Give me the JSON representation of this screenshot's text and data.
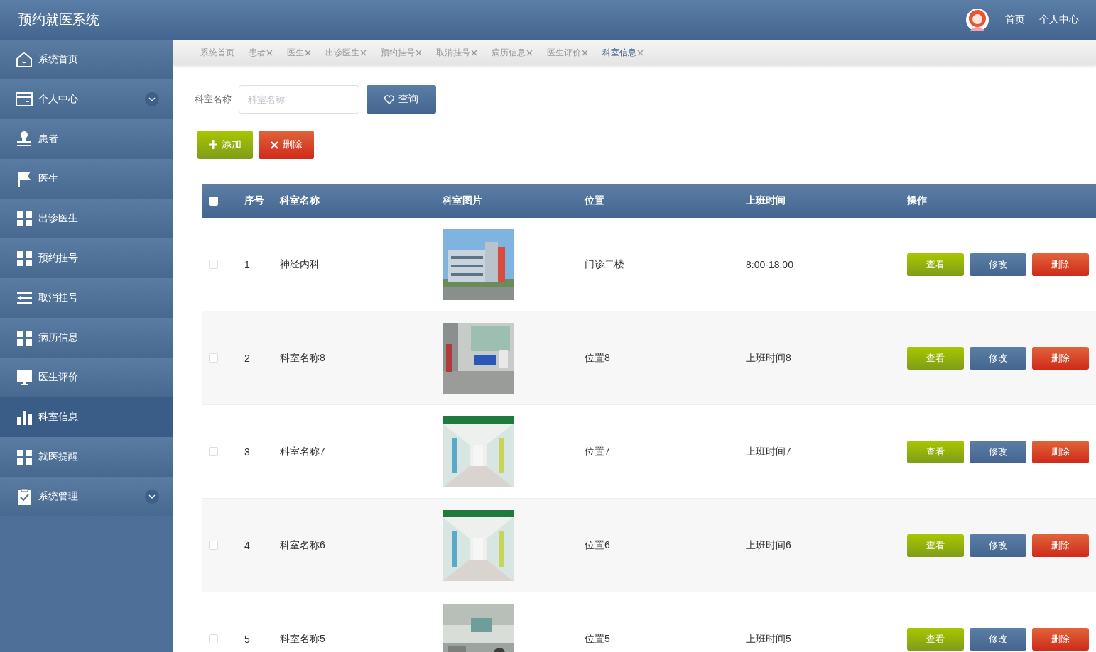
{
  "header": {
    "title": "预约就医系统",
    "nav": [
      "首页",
      "个人中心"
    ]
  },
  "sidebar": {
    "items": [
      {
        "label": "系统首页",
        "selected": false,
        "expandable": false
      },
      {
        "label": "个人中心",
        "selected": false,
        "expandable": true
      },
      {
        "label": "患者",
        "selected": false,
        "expandable": false
      },
      {
        "label": "医生",
        "selected": false,
        "expandable": false
      },
      {
        "label": "出诊医生",
        "selected": false,
        "expandable": false
      },
      {
        "label": "预约挂号",
        "selected": false,
        "expandable": false
      },
      {
        "label": "取消挂号",
        "selected": false,
        "expandable": false
      },
      {
        "label": "病历信息",
        "selected": false,
        "expandable": false
      },
      {
        "label": "医生评价",
        "selected": false,
        "expandable": false
      },
      {
        "label": "科室信息",
        "selected": true,
        "expandable": false
      },
      {
        "label": "就医提醒",
        "selected": false,
        "expandable": false
      },
      {
        "label": "系统管理",
        "selected": false,
        "expandable": true
      }
    ]
  },
  "tabs": [
    {
      "label": "系统首页",
      "closable": false,
      "selected": false
    },
    {
      "label": "患者",
      "closable": true,
      "selected": false
    },
    {
      "label": "医生",
      "closable": true,
      "selected": false
    },
    {
      "label": "出诊医生",
      "closable": true,
      "selected": false
    },
    {
      "label": "预约挂号",
      "closable": true,
      "selected": false
    },
    {
      "label": "取消挂号",
      "closable": true,
      "selected": false
    },
    {
      "label": "病历信息",
      "closable": true,
      "selected": false
    },
    {
      "label": "医生评价",
      "closable": true,
      "selected": false
    },
    {
      "label": "科室信息",
      "closable": true,
      "selected": true
    }
  ],
  "search": {
    "label": "科室名称",
    "placeholder": "科室名称",
    "button": "查询"
  },
  "actions": {
    "add": "添加",
    "delete": "删除"
  },
  "table": {
    "select_all": {
      "checked": false
    },
    "columns": [
      "序号",
      "科室名称",
      "科室图片",
      "位置",
      "上班时间",
      "操作"
    ],
    "rows": [
      {
        "checked": false,
        "index": "1",
        "name": "神经内科",
        "location": "门诊二楼",
        "hours": "8:00-18:00",
        "buttons": [
          "查看",
          "修改",
          "删除"
        ]
      },
      {
        "checked": false,
        "index": "2",
        "name": "科室名称8",
        "location": "位置8",
        "hours": "上班时间8",
        "buttons": [
          "查看",
          "修改",
          "删除"
        ]
      },
      {
        "checked": false,
        "index": "3",
        "name": "科室名称7",
        "location": "位置7",
        "hours": "上班时间7",
        "buttons": [
          "查看",
          "修改",
          "删除"
        ]
      },
      {
        "checked": false,
        "index": "4",
        "name": "科室名称6",
        "location": "位置6",
        "hours": "上班时间6",
        "buttons": [
          "查看",
          "修改",
          "删除"
        ]
      },
      {
        "checked": false,
        "index": "5",
        "name": "科室名称5",
        "location": "位置5",
        "hours": "上班时间5",
        "buttons": [
          "查看",
          "修改",
          "删除"
        ]
      }
    ]
  }
}
